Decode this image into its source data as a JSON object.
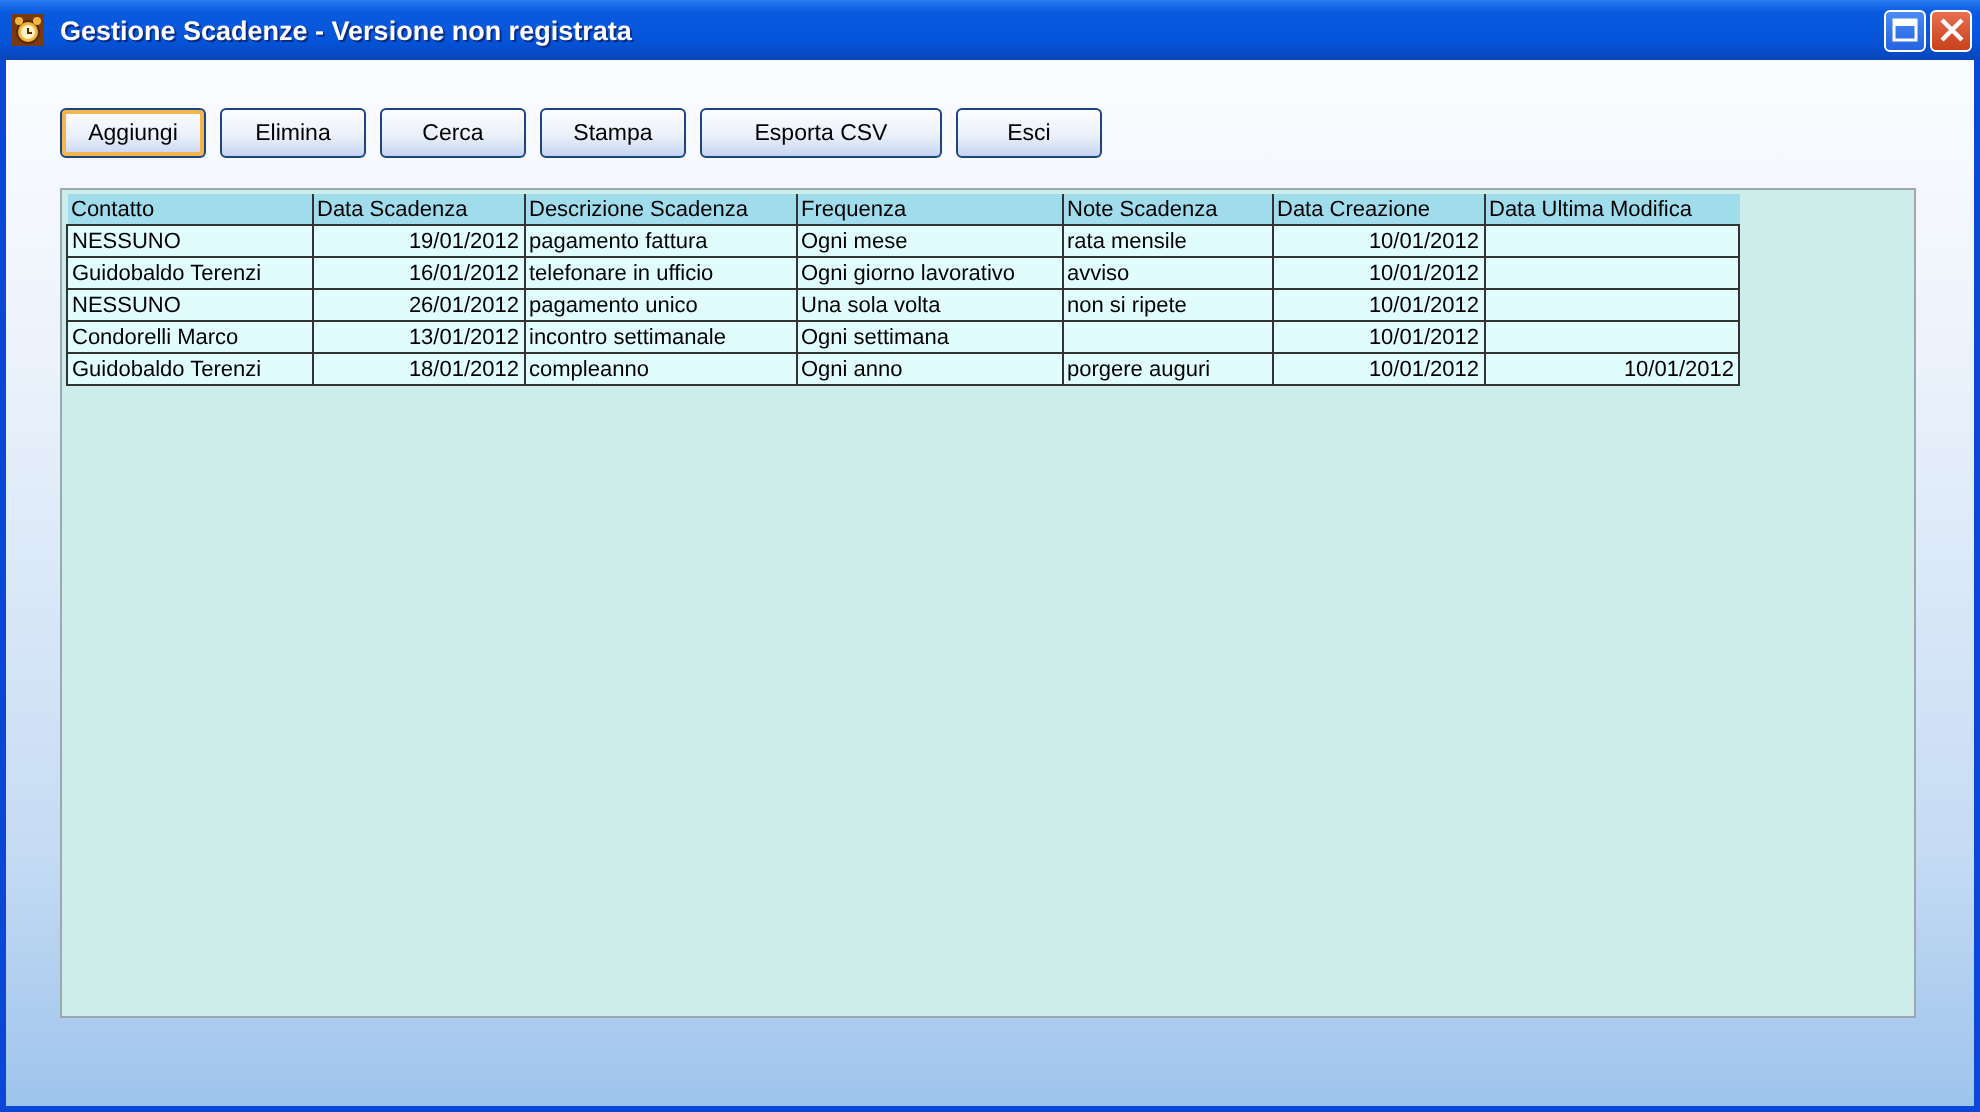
{
  "window": {
    "title": "Gestione Scadenze - Versione non registrata"
  },
  "buttons": [
    {
      "label": "Aggiungi",
      "focused": true
    },
    {
      "label": "Elimina",
      "focused": false
    },
    {
      "label": "Cerca",
      "focused": false
    },
    {
      "label": "Stampa",
      "focused": false
    },
    {
      "label": "Esporta CSV",
      "focused": false
    },
    {
      "label": "Esci",
      "focused": false
    }
  ],
  "table": {
    "columns": [
      {
        "label": "Contatto",
        "kind": "text"
      },
      {
        "label": "Data Scadenza",
        "kind": "date"
      },
      {
        "label": "Descrizione Scadenza",
        "kind": "text"
      },
      {
        "label": "Frequenza",
        "kind": "text"
      },
      {
        "label": "Note Scadenza",
        "kind": "text"
      },
      {
        "label": "Data Creazione",
        "kind": "date"
      },
      {
        "label": "Data Ultima Modifica",
        "kind": "date"
      }
    ],
    "rows": [
      [
        "NESSUNO",
        "19/01/2012",
        "pagamento fattura",
        "Ogni mese",
        "rata mensile",
        "10/01/2012",
        null
      ],
      [
        "Guidobaldo Terenzi",
        "16/01/2012",
        "telefonare in ufficio",
        "Ogni giorno lavorativo",
        "avviso",
        "10/01/2012",
        null
      ],
      [
        "NESSUNO",
        "26/01/2012",
        "pagamento unico",
        "Una sola volta",
        "non si ripete",
        "10/01/2012",
        null
      ],
      [
        "Condorelli Marco",
        "13/01/2012",
        "incontro settimanale",
        "Ogni settimana",
        null,
        "10/01/2012",
        null
      ],
      [
        "Guidobaldo Terenzi",
        "18/01/2012",
        "compleanno",
        "Ogni anno",
        "porgere auguri",
        "10/01/2012",
        "10/01/2012"
      ]
    ]
  }
}
